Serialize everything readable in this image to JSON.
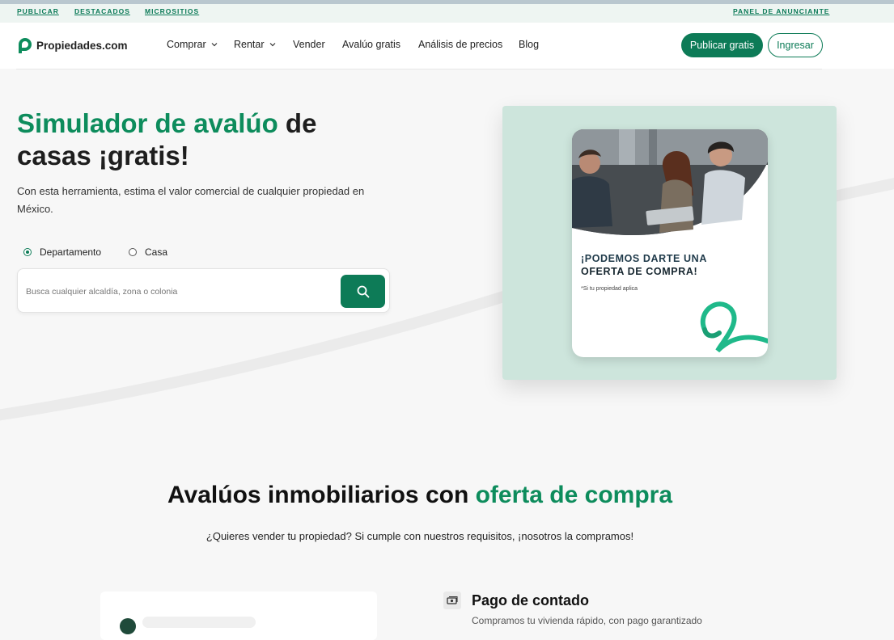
{
  "topbar": {
    "links": [
      "PUBLICAR",
      "DESTACADOS",
      "MICROSITIOS"
    ],
    "advertiser_panel": "PANEL DE ANUNCIANTE"
  },
  "brand": {
    "name": "Propiedades.com",
    "accent": "#0d7b57",
    "highlight_text": "#0d8c5c"
  },
  "nav": {
    "items": [
      {
        "label": "Comprar",
        "dropdown": true
      },
      {
        "label": "Rentar",
        "dropdown": true
      },
      {
        "label": "Vender",
        "dropdown": false
      },
      {
        "label": "Avalúo gratis",
        "dropdown": false
      },
      {
        "label": "Análisis de precios",
        "dropdown": false
      },
      {
        "label": "Blog",
        "dropdown": false
      }
    ],
    "publish_button": "Publicar gratis",
    "login_button": "Ingresar"
  },
  "hero": {
    "title_highlight": "Simulador de avalúo",
    "title_rest_1": " de",
    "title_rest_2": "casas ¡gratis!",
    "subtitle": "Con esta herramienta, estima el valor comercial de cualquier propiedad en México.",
    "property_types": [
      {
        "label": "Departamento",
        "selected": true
      },
      {
        "label": "Casa",
        "selected": false
      }
    ],
    "search": {
      "placeholder": "Busca cualquier alcaldía, zona o colonia",
      "value": "",
      "icon": "search-icon"
    }
  },
  "promo": {
    "line1": "¡PODEMOS DARTE UNA",
    "line2": "OFERTA DE COMPRA!",
    "note": "*Si tu propiedad aplica",
    "panel_color": "#cde5dc"
  },
  "section": {
    "title_part1": "Avalúos inmobiliarios con ",
    "title_highlight": "oferta de compra",
    "subtitle": "¿Quieres vender tu propiedad? Si cumple con nuestros requisitos, ¡nosotros la compramos!"
  },
  "features": [
    {
      "title": "Pago de contado",
      "icon": "cash-icon",
      "desc": "Compramos tu vivienda rápido, con pago garantizado"
    }
  ]
}
